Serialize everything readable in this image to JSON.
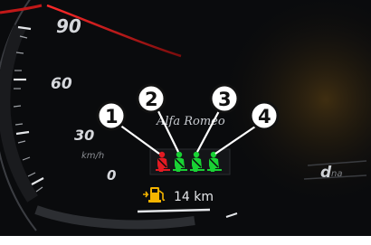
{
  "speedometer": {
    "ticks": [
      "90",
      "60",
      "30",
      "0"
    ],
    "unit": "km/h"
  },
  "brand": "Alfa Romeo",
  "seatbelt_callouts": [
    "1",
    "2",
    "3",
    "4"
  ],
  "seatbelt_status": [
    {
      "seat": "1",
      "state": "unfastened",
      "color": "#e21b23"
    },
    {
      "seat": "2",
      "state": "fastened",
      "color": "#19d234"
    },
    {
      "seat": "3",
      "state": "fastened",
      "color": "#19d234"
    },
    {
      "seat": "4",
      "state": "fastened",
      "color": "#19d234"
    }
  ],
  "fuel": {
    "icon": "fuel-pump-icon",
    "range": "14 km",
    "color": "#f5b400"
  },
  "drive_mode": {
    "letter": "d",
    "suffix": "na"
  }
}
